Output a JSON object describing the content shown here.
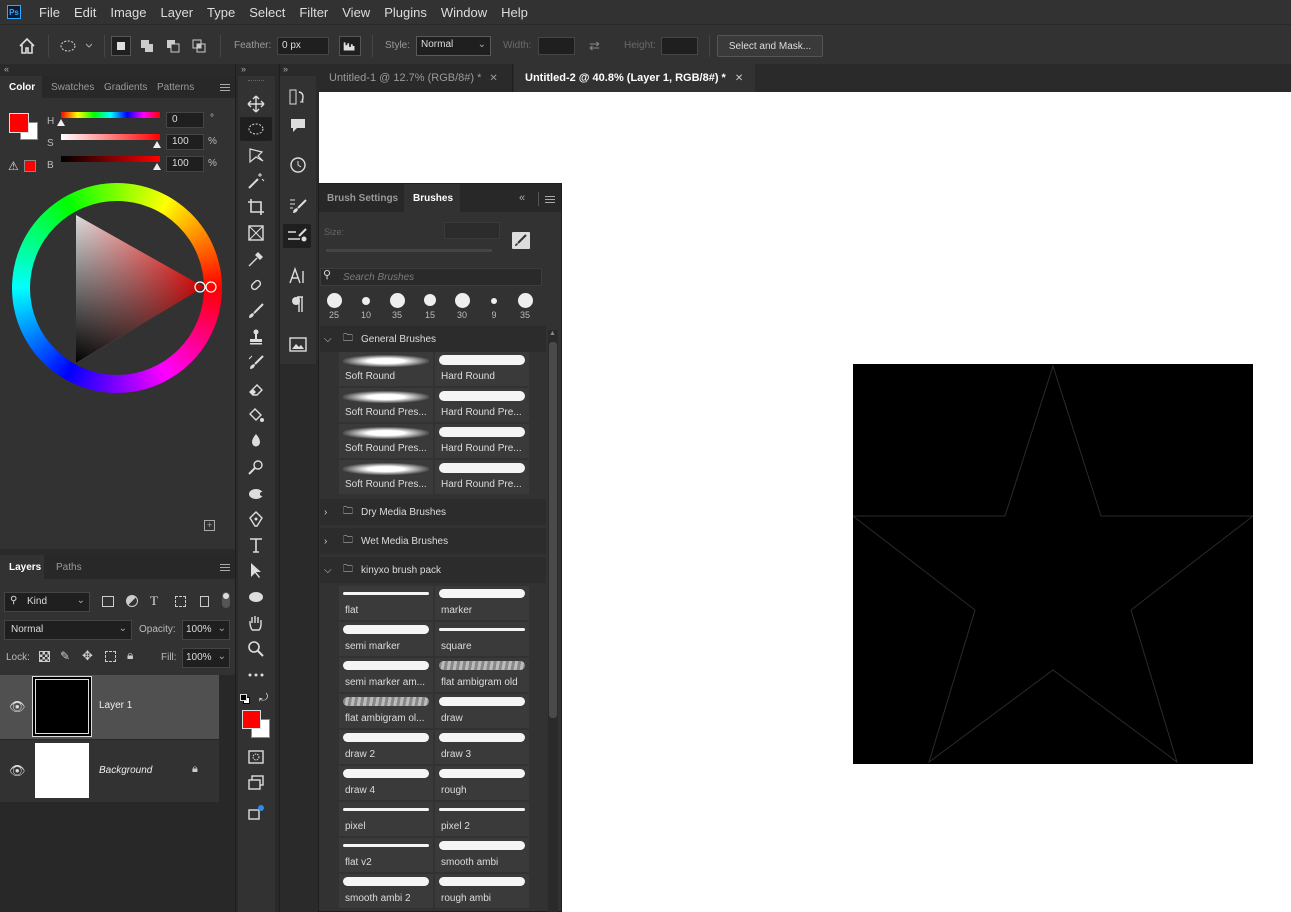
{
  "menu": [
    "File",
    "Edit",
    "Image",
    "Layer",
    "Type",
    "Select",
    "Filter",
    "View",
    "Plugins",
    "Window",
    "Help"
  ],
  "logo": "Ps",
  "options": {
    "feather_label": "Feather:",
    "feather_value": "0 px",
    "style_label": "Style:",
    "style_value": "Normal",
    "width_label": "Width:",
    "height_label": "Height:",
    "select_mask": "Select and Mask..."
  },
  "color_panel": {
    "tabs": [
      "Color",
      "Swatches",
      "Gradients",
      "Patterns"
    ],
    "h_label": "H",
    "s_label": "S",
    "b_label": "B",
    "h_value": "0",
    "s_value": "100",
    "b_value": "100",
    "h_unit": "°",
    "s_unit": "%",
    "b_unit": "%",
    "foreground": "#ff0000",
    "background": "#ffffff"
  },
  "layers_panel": {
    "tabs": [
      "Layers",
      "Paths"
    ],
    "kind": "Kind",
    "blend": "Normal",
    "opacity_label": "Opacity:",
    "opacity_value": "100%",
    "lock_label": "Lock:",
    "fill_label": "Fill:",
    "fill_value": "100%",
    "layers": [
      {
        "name": "Layer 1",
        "selected": true
      },
      {
        "name": "Background",
        "locked": true
      }
    ]
  },
  "doc_tabs": [
    {
      "label": "Untitled-1 @ 12.7% (RGB/8#) *",
      "active": false
    },
    {
      "label": "Untitled-2 @ 40.8% (Layer 1, RGB/8#) *",
      "active": true
    }
  ],
  "brushes_panel": {
    "tabs": [
      "Brush Settings",
      "Brushes"
    ],
    "size_label": "Size:",
    "search_placeholder": "Search Brushes",
    "presets": [
      "25",
      "10",
      "35",
      "15",
      "30",
      "9",
      "35"
    ],
    "folders": [
      {
        "name": "General Brushes",
        "open": true
      },
      {
        "name": "Dry Media Brushes",
        "open": false
      },
      {
        "name": "Wet Media Brushes",
        "open": false
      },
      {
        "name": "kinyxo brush pack",
        "open": true
      }
    ],
    "general_brushes": [
      "Soft Round",
      "Hard Round",
      "Soft Round Pres...",
      "Hard Round Pre...",
      "Soft Round Pres...",
      "Hard Round Pre...",
      "Soft Round Pres...",
      "Hard Round Pre..."
    ],
    "kinyxo_brushes": [
      "flat",
      "marker",
      "semi marker",
      "square",
      "semi marker am...",
      "flat ambigram old",
      "flat ambigram ol...",
      "draw",
      "draw 2",
      "draw 3",
      "draw 4",
      "rough",
      "pixel",
      "pixel 2",
      "flat v2",
      "smooth ambi",
      "smooth ambi 2",
      "rough ambi"
    ]
  },
  "icons": {
    "home": "home-icon",
    "marquee": "ellipse-marquee-icon",
    "move": "move-icon",
    "lasso": "lasso-icon",
    "hand": "hand-icon",
    "zoom": "zoom-icon"
  }
}
